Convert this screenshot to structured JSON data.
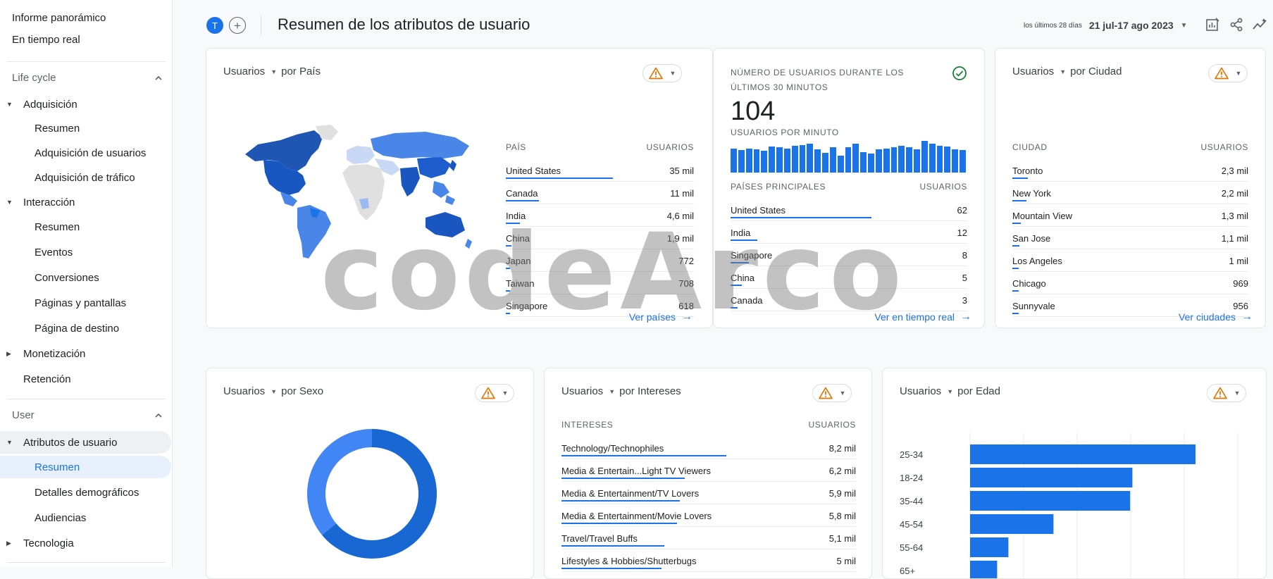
{
  "sidebar": {
    "top_items": [
      "Informe panorámico",
      "En tiempo real"
    ],
    "section_lifecycle": "Life cycle",
    "adquisicion": "Adquisición",
    "adq_resumen": "Resumen",
    "adq_usuarios": "Adquisición de usuarios",
    "adq_trafico": "Adquisición de tráfico",
    "interaccion": "Interacción",
    "int_resumen": "Resumen",
    "int_eventos": "Eventos",
    "int_conversiones": "Conversiones",
    "int_paginas": "Páginas y pantallas",
    "int_destino": "Página de destino",
    "monetizacion": "Monetización",
    "retencion": "Retención",
    "section_user": "User",
    "atributos": "Atributos de usuario",
    "atr_resumen": "Resumen",
    "atr_detalles": "Detalles demográficos",
    "atr_audiencias": "Audiencias",
    "tecnologia": "Tecnologia"
  },
  "header": {
    "avatar_letter": "T",
    "title": "Resumen de los atributos de usuario",
    "date_small": "los últimos 28 días",
    "date_range": "21 jul-17 ago 2023"
  },
  "country_card": {
    "metric": "Usuarios",
    "dimension": "por País",
    "col_name": "PAÍS",
    "col_value": "USUARIOS",
    "rows": [
      {
        "name": "United States",
        "value": "35 mil",
        "frac": 1.0
      },
      {
        "name": "Canada",
        "value": "11 mil",
        "frac": 0.31
      },
      {
        "name": "India",
        "value": "4,6 mil",
        "frac": 0.13
      },
      {
        "name": "China",
        "value": "1,9 mil",
        "frac": 0.054
      },
      {
        "name": "Japan",
        "value": "772",
        "frac": 0.022
      },
      {
        "name": "Taiwan",
        "value": "708",
        "frac": 0.02
      },
      {
        "name": "Singapore",
        "value": "618",
        "frac": 0.018
      }
    ],
    "link": "Ver países"
  },
  "realtime_card": {
    "heading": "NÚMERO DE USUARIOS DURANTE LOS ÚLTIMOS 30 MINUTOS",
    "count": "104",
    "per_minute": "USUARIOS POR MINUTO",
    "bars": [
      0.75,
      0.7,
      0.75,
      0.72,
      0.68,
      0.8,
      0.78,
      0.75,
      0.82,
      0.85,
      0.9,
      0.72,
      0.6,
      0.78,
      0.52,
      0.78,
      0.9,
      0.62,
      0.58,
      0.72,
      0.75,
      0.78,
      0.82,
      0.78,
      0.72,
      0.98,
      0.9,
      0.82,
      0.8,
      0.72,
      0.7
    ],
    "col_name": "PAÍSES PRINCIPALES",
    "col_value": "USUARIOS",
    "rows": [
      {
        "name": "United States",
        "value": "62",
        "frac": 1.0
      },
      {
        "name": "India",
        "value": "12",
        "frac": 0.19
      },
      {
        "name": "Singapore",
        "value": "8",
        "frac": 0.13
      },
      {
        "name": "China",
        "value": "5",
        "frac": 0.08
      },
      {
        "name": "Canada",
        "value": "3",
        "frac": 0.05
      }
    ],
    "link": "Ver en tiempo real"
  },
  "city_card": {
    "metric": "Usuarios",
    "dimension": "por Ciudad",
    "col_name": "CIUDAD",
    "col_value": "USUARIOS",
    "rows": [
      {
        "name": "Toronto",
        "value": "2,3 mil",
        "frac": 0.09
      },
      {
        "name": "New York",
        "value": "2,2 mil",
        "frac": 0.085
      },
      {
        "name": "Mountain View",
        "value": "1,3 mil",
        "frac": 0.05
      },
      {
        "name": "San Jose",
        "value": "1,1 mil",
        "frac": 0.043
      },
      {
        "name": "Los Angeles",
        "value": "1 mil",
        "frac": 0.039
      },
      {
        "name": "Chicago",
        "value": "969",
        "frac": 0.037
      },
      {
        "name": "Sunnyvale",
        "value": "956",
        "frac": 0.036
      }
    ],
    "link": "Ver ciudades"
  },
  "sex_card": {
    "metric": "Usuarios",
    "dimension": "por Sexo",
    "donut": [
      0.64,
      0.36
    ]
  },
  "interests_card": {
    "metric": "Usuarios",
    "dimension": "por Intereses",
    "col_name": "INTERESES",
    "col_value": "USUARIOS",
    "rows": [
      {
        "name": "Technology/Technophiles",
        "value": "8,2 mil",
        "frac": 0.64
      },
      {
        "name": "Media & Entertain...Light TV Viewers",
        "value": "6,2 mil",
        "frac": 0.48
      },
      {
        "name": "Media & Entertainment/TV Lovers",
        "value": "5,9 mil",
        "frac": 0.46
      },
      {
        "name": "Media & Entertainment/Movie Lovers",
        "value": "5,8 mil",
        "frac": 0.45
      },
      {
        "name": "Travel/Travel Buffs",
        "value": "5,1 mil",
        "frac": 0.4
      },
      {
        "name": "Lifestyles & Hobbies/Shutterbugs",
        "value": "5 mil",
        "frac": 0.39
      }
    ]
  },
  "age_card": {
    "metric": "Usuarios",
    "dimension": "por Edad"
  },
  "chart_data": {
    "type": "bar",
    "categories": [
      "25-34",
      "18-24",
      "35-44",
      "45-54",
      "55-64",
      "65+"
    ],
    "values": [
      1.0,
      0.72,
      0.71,
      0.37,
      0.17,
      0.12
    ],
    "title": "",
    "xlabel": "",
    "ylabel": ""
  },
  "colors": {
    "primary": "#1a73e8",
    "dark_blue": "#1967d2",
    "light_blue": "#4285f4",
    "warning": "#e37400"
  },
  "icons": [
    "warning-icon",
    "chevron-down-icon",
    "check-circle-icon",
    "arrow-right-icon",
    "customize-report-icon",
    "share-icon",
    "insights-icon"
  ]
}
